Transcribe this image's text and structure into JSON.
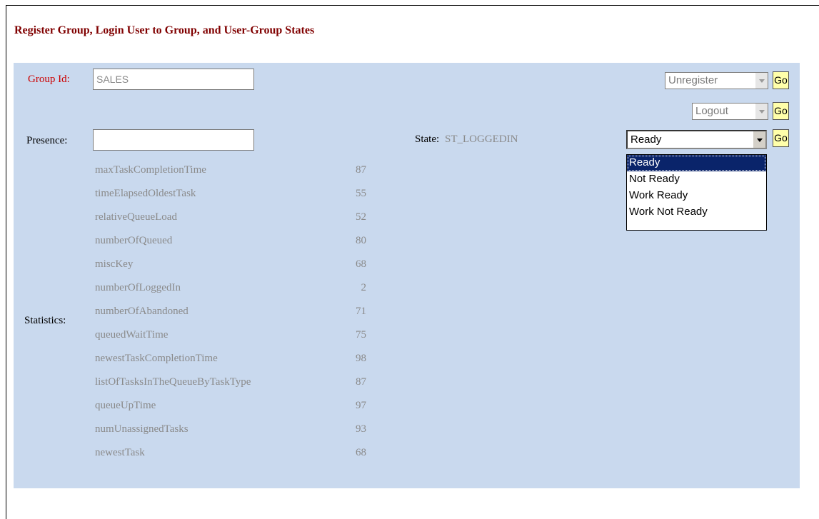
{
  "title": "Register Group, Login User to Group, and User-Group States",
  "group": {
    "label": "Group Id:",
    "value": "SALES",
    "action_select": "Unregister",
    "go_label": "Go"
  },
  "logout": {
    "select_value": "Logout",
    "go_label": "Go"
  },
  "presence": {
    "label": "Presence:",
    "value": ""
  },
  "state": {
    "label": "State:",
    "value": "ST_LOGGEDIN",
    "select_value": "Ready",
    "go_label": "Go",
    "options": [
      "Ready",
      "Not Ready",
      "Work Ready",
      "Work Not Ready"
    ]
  },
  "statistics": {
    "label": "Statistics:",
    "rows": [
      {
        "name": "maxTaskCompletionTime",
        "value": "87"
      },
      {
        "name": "timeElapsedOldestTask",
        "value": "55"
      },
      {
        "name": "relativeQueueLoad",
        "value": "52"
      },
      {
        "name": "numberOfQueued",
        "value": "80"
      },
      {
        "name": "miscKey",
        "value": "68"
      },
      {
        "name": "numberOfLoggedIn",
        "value": "2"
      },
      {
        "name": "numberOfAbandoned",
        "value": "71"
      },
      {
        "name": "queuedWaitTime",
        "value": "75"
      },
      {
        "name": "newestTaskCompletionTime",
        "value": "98"
      },
      {
        "name": "listOfTasksInTheQueueByTaskType",
        "value": "87"
      },
      {
        "name": "queueUpTime",
        "value": "97"
      },
      {
        "name": "numUnassignedTasks",
        "value": "93"
      },
      {
        "name": "newestTask",
        "value": "68"
      }
    ]
  }
}
